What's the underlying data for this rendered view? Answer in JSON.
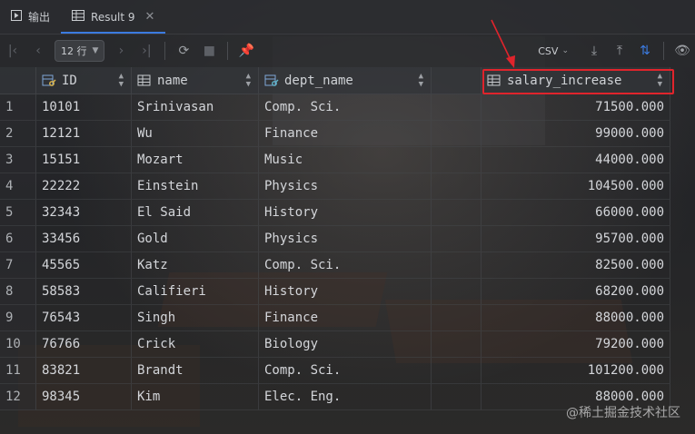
{
  "tabs": [
    {
      "label": "输出",
      "icon": "play-console-icon",
      "active": false
    },
    {
      "label": "Result 9",
      "icon": "table-icon",
      "active": true,
      "closable": true
    }
  ],
  "toolbar": {
    "rows_label": "12 行",
    "export_format": "CSV"
  },
  "columns": [
    {
      "label": "ID",
      "icon": "key-column-icon"
    },
    {
      "label": "name",
      "icon": "column-icon"
    },
    {
      "label": "dept_name",
      "icon": "foreign-key-column-icon"
    },
    {
      "label": "salary_increase",
      "icon": "column-icon"
    }
  ],
  "rows": [
    {
      "n": "1",
      "id": "10101",
      "name": "Srinivasan",
      "dept": "Comp. Sci.",
      "salary": "71500.000"
    },
    {
      "n": "2",
      "id": "12121",
      "name": "Wu",
      "dept": "Finance",
      "salary": "99000.000"
    },
    {
      "n": "3",
      "id": "15151",
      "name": "Mozart",
      "dept": "Music",
      "salary": "44000.000"
    },
    {
      "n": "4",
      "id": "22222",
      "name": "Einstein",
      "dept": "Physics",
      "salary": "104500.000"
    },
    {
      "n": "5",
      "id": "32343",
      "name": "El Said",
      "dept": "History",
      "salary": "66000.000"
    },
    {
      "n": "6",
      "id": "33456",
      "name": "Gold",
      "dept": "Physics",
      "salary": "95700.000"
    },
    {
      "n": "7",
      "id": "45565",
      "name": "Katz",
      "dept": "Comp. Sci.",
      "salary": "82500.000"
    },
    {
      "n": "8",
      "id": "58583",
      "name": "Califieri",
      "dept": "History",
      "salary": "68200.000"
    },
    {
      "n": "9",
      "id": "76543",
      "name": "Singh",
      "dept": "Finance",
      "salary": "88000.000"
    },
    {
      "n": "10",
      "id": "76766",
      "name": "Crick",
      "dept": "Biology",
      "salary": "79200.000"
    },
    {
      "n": "11",
      "id": "83821",
      "name": "Brandt",
      "dept": "Comp. Sci.",
      "salary": "101200.000"
    },
    {
      "n": "12",
      "id": "98345",
      "name": "Kim",
      "dept": "Elec. Eng.",
      "salary": "88000.000"
    }
  ],
  "watermark": "@稀土掘金技术社区",
  "colors": {
    "accent": "#3b7be0",
    "highlight": "#e0242c"
  }
}
